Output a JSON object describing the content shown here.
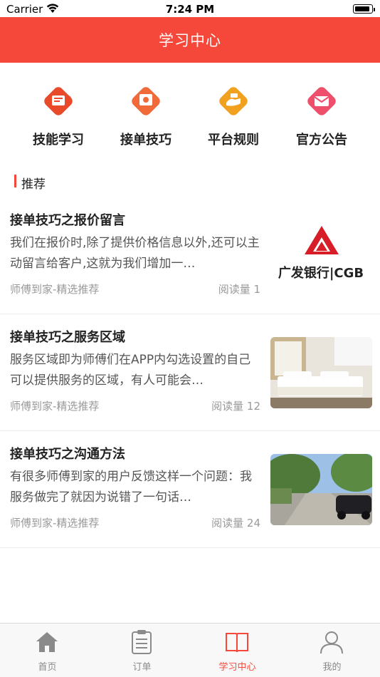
{
  "status_bar": {
    "carrier": "Carrier",
    "time": "7:24 PM"
  },
  "nav": {
    "title": "学习中心"
  },
  "categories": [
    {
      "label": "技能学习",
      "icon": "skill-learning-icon",
      "color": "#e84a2a"
    },
    {
      "label": "接单技巧",
      "icon": "order-tips-icon",
      "color": "#f06a3a"
    },
    {
      "label": "平台规则",
      "icon": "platform-rules-icon",
      "color": "#f2a020"
    },
    {
      "label": "官方公告",
      "icon": "announcement-icon",
      "color": "#ee4f6a"
    }
  ],
  "section": {
    "title": "推荐"
  },
  "articles": [
    {
      "title": "接单技巧之报价留言",
      "summary": "我们在报价时,除了提供价格信息以外,还可以主动留言给客户,这就为我们增加一…",
      "source": "师傅到家-精选推荐",
      "reads": "阅读量 1",
      "thumb_text": "广发银行|CGB"
    },
    {
      "title": "接单技巧之服务区域",
      "summary": "服务区域即为师傅们在APP内勾选设置的自己可以提供服务的区域，有人可能会…",
      "source": "师傅到家-精选推荐",
      "reads": "阅读量 12"
    },
    {
      "title": "接单技巧之沟通方法",
      "summary": "有很多师傅到家的用户反馈这样一个问题：我服务做完了就因为说错了一句话…",
      "source": "师傅到家-精选推荐",
      "reads": "阅读量 24"
    }
  ],
  "tabs": [
    {
      "label": "首页",
      "icon": "home-icon",
      "active": false
    },
    {
      "label": "订单",
      "icon": "clipboard-icon",
      "active": false
    },
    {
      "label": "学习中心",
      "icon": "book-icon",
      "active": true
    },
    {
      "label": "我的",
      "icon": "profile-icon",
      "active": false
    }
  ],
  "colors": {
    "brand": "#f5473a",
    "inactive_tab": "#8a8a8a"
  }
}
